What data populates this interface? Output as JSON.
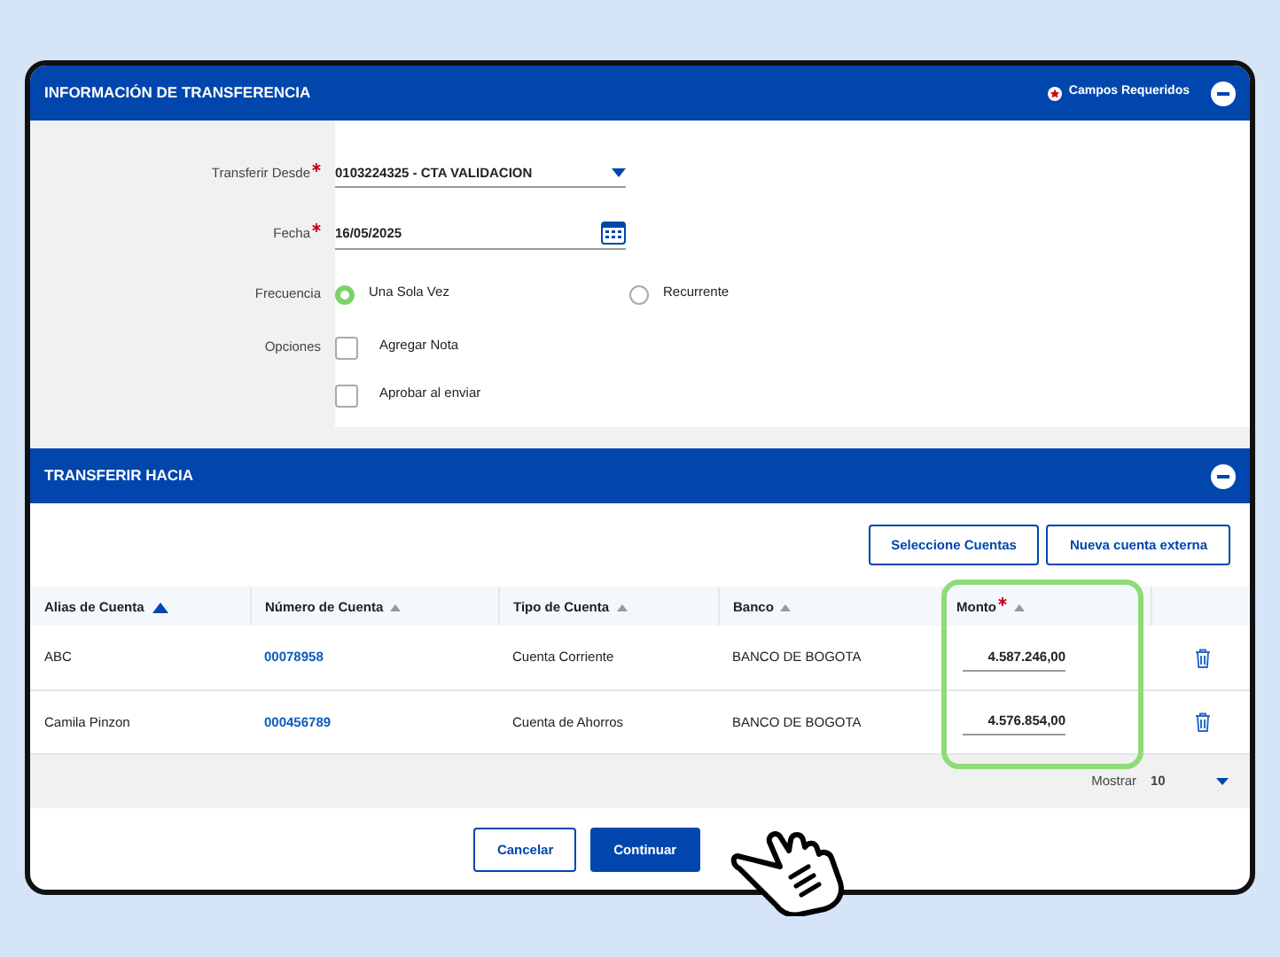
{
  "transfer_info": {
    "title": "INFORMACIÓN DE TRANSFERENCIA",
    "required_note": "Campos Requeridos",
    "fields": [
      {
        "kind": "select",
        "label": "Transferir Desde",
        "required": true,
        "value": "0103224325 - CTA VALIDACION"
      },
      {
        "kind": "date",
        "label": "Fecha",
        "required": true,
        "value": "16/05/2025"
      },
      {
        "kind": "radio",
        "label": "Frecuencia",
        "options": [
          {
            "label": "Una Sola Vez",
            "selected": true
          },
          {
            "label": "Recurrente",
            "selected": false
          }
        ]
      },
      {
        "kind": "checkbox",
        "label": "Opciones",
        "options": [
          {
            "label": "Agregar Nota",
            "checked": false
          },
          {
            "label": "Aprobar al enviar",
            "checked": false
          }
        ]
      }
    ]
  },
  "transfer_to": {
    "title": "TRANSFERIR HACIA",
    "buttons": [
      "Seleccione Cuentas",
      "Nueva cuenta externa"
    ],
    "columns": [
      {
        "label": "Alias de Cuenta",
        "sorted": true
      },
      {
        "label": "Número de Cuenta",
        "sorted": false
      },
      {
        "label": "Tipo de Cuenta",
        "sorted": false
      },
      {
        "label": "Banco",
        "sorted": false
      },
      {
        "label": "Monto",
        "sorted": false,
        "required": true,
        "highlighted": true
      }
    ],
    "rows": [
      {
        "alias": "ABC",
        "number": "00078958",
        "type": "Cuenta Corriente",
        "bank": "BANCO DE BOGOTA",
        "amount": "4.587.246,00"
      },
      {
        "alias": "Camila Pinzon",
        "number": "000456789",
        "type": "Cuenta de Ahorros",
        "bank": "BANCO DE BOGOTA",
        "amount": "4.576.854,00"
      }
    ],
    "page_size_label": "Mostrar",
    "page_size": "10"
  },
  "actions": [
    "Cancelar",
    "Continuar"
  ]
}
